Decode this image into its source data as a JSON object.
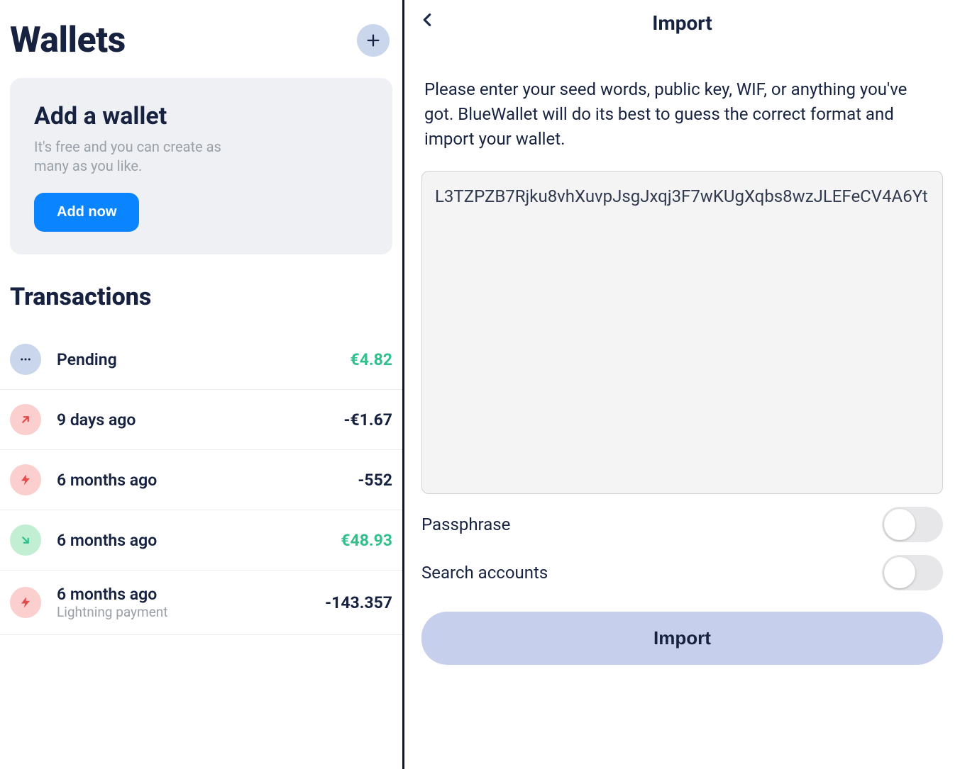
{
  "left": {
    "title": "Wallets",
    "addCard": {
      "title": "Add a wallet",
      "subtitle": "It's free and you can create as many as you like.",
      "button": "Add now"
    },
    "txTitle": "Transactions",
    "transactions": [
      {
        "label": "Pending",
        "sub": "",
        "amount": "€4.82",
        "amountClass": "amt-green",
        "iconType": "dots",
        "iconClass": "icon-blue"
      },
      {
        "label": "9 days ago",
        "sub": "",
        "amount": "-€1.67",
        "amountClass": "amt-dark",
        "iconType": "arrow-out",
        "iconClass": "icon-red"
      },
      {
        "label": "6 months ago",
        "sub": "",
        "amount": "-552",
        "amountClass": "amt-dark",
        "iconType": "bolt",
        "iconClass": "icon-red"
      },
      {
        "label": "6 months ago",
        "sub": "",
        "amount": "€48.93",
        "amountClass": "amt-green",
        "iconType": "arrow-in",
        "iconClass": "icon-green"
      },
      {
        "label": "6 months ago",
        "sub": "Lightning payment",
        "amount": "-143.357",
        "amountClass": "amt-dark",
        "iconType": "bolt",
        "iconClass": "icon-red"
      }
    ]
  },
  "right": {
    "title": "Import",
    "description": "Please enter your seed words, public key, WIF, or anything you've got. BlueWallet will do its best to guess the correct format and import your wallet.",
    "seedValue": "L3TZPZB7Rjku8vhXuvpJsgJxqj3F7wKUgXqbs8wzJLEFeCV4A6Yt",
    "toggles": [
      {
        "label": "Passphrase"
      },
      {
        "label": "Search accounts"
      }
    ],
    "importButton": "Import"
  }
}
